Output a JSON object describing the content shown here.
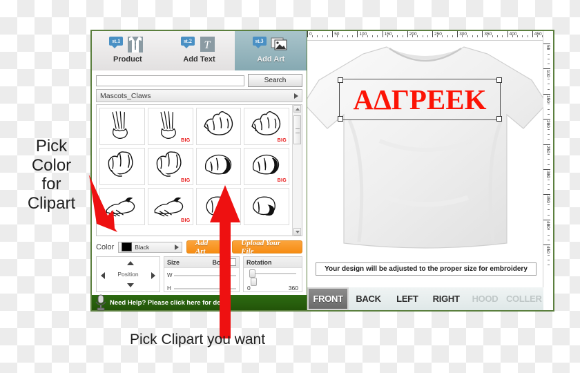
{
  "app": {
    "steps": [
      {
        "badge": "st.1",
        "label": "Product",
        "icon": "polo-shirt-icon",
        "active": false
      },
      {
        "badge": "st.2",
        "label": "Add Text",
        "icon": "text-t-icon",
        "active": false
      },
      {
        "badge": "st.3",
        "label": "Add Art",
        "icon": "image-stack-icon",
        "active": true
      }
    ],
    "search": {
      "value": "",
      "placeholder": "",
      "button_label": "Search"
    },
    "category": {
      "selected": "Mascots_Claws"
    },
    "clipart": {
      "items": [
        {
          "name": "claw-slash-1",
          "big": false
        },
        {
          "name": "claw-slash-2",
          "big": true,
          "big_label": "BIG"
        },
        {
          "name": "paw-claw-3",
          "big": false
        },
        {
          "name": "paw-claw-4",
          "big": true,
          "big_label": "BIG"
        },
        {
          "name": "paw-claw-5",
          "big": false
        },
        {
          "name": "paw-claw-6",
          "big": true,
          "big_label": "BIG"
        },
        {
          "name": "claw-grip-7",
          "big": false
        },
        {
          "name": "claw-grip-8",
          "big": true,
          "big_label": "BIG"
        },
        {
          "name": "claw-sweep-9",
          "big": false
        },
        {
          "name": "claw-sweep-10",
          "big": true,
          "big_label": "BIG"
        },
        {
          "name": "paw-claw-11",
          "big": false
        },
        {
          "name": "paw-claw-12",
          "big": false
        }
      ]
    },
    "color": {
      "label": "Color",
      "value": "Black",
      "hex": "#000000"
    },
    "actions": {
      "add_art": "Add Art",
      "upload": "Upload Your File"
    },
    "position": {
      "label": "Position"
    },
    "size": {
      "title": "Size",
      "both_label": "Both",
      "w_label": "W",
      "h_label": "H"
    },
    "rotation": {
      "title": "Rotation",
      "min": "0",
      "max": "360"
    },
    "help": {
      "text": "Need Help? Please click here for demo"
    }
  },
  "canvas": {
    "ruler_h": [
      "0",
      "50",
      "100",
      "150",
      "200",
      "250",
      "300",
      "350",
      "400",
      "450"
    ],
    "ruler_v": [
      "50",
      "100",
      "150",
      "200",
      "250",
      "300",
      "350",
      "400",
      "450"
    ],
    "design_text": "ΑΔΓΡΕΕΚ",
    "design_color": "#fc1305",
    "notice": "Your design will be adjusted to the proper size for embroidery",
    "views": [
      {
        "label": "FRONT",
        "state": "active"
      },
      {
        "label": "BACK",
        "state": "normal"
      },
      {
        "label": "LEFT",
        "state": "normal"
      },
      {
        "label": "RIGHT",
        "state": "normal"
      },
      {
        "label": "HOOD",
        "state": "disabled"
      },
      {
        "label": "COLLER",
        "state": "disabled"
      }
    ]
  },
  "annotations": {
    "left": "Pick\nColor\nfor\nClipart",
    "left_lines": [
      "Pick",
      "Color",
      "for",
      "Clipart"
    ],
    "bottom": "Pick Clipart  you want",
    "arrow_color": "#ee1111"
  }
}
